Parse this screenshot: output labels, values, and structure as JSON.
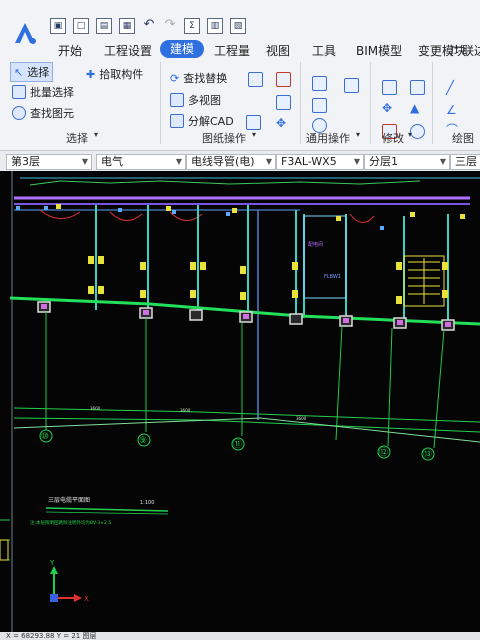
{
  "quick_access": {
    "items": [
      "file-icon",
      "new-icon",
      "open-icon",
      "save-icon",
      "undo-icon",
      "redo-icon",
      "sum-icon",
      "calc-icon",
      "report-icon"
    ]
  },
  "tabs": [
    "开始",
    "工程设置",
    "建模",
    "工程量",
    "视图",
    "工具",
    "BIM模型",
    "变更模块"
  ],
  "brand": "广联达",
  "select_group": {
    "select": "选择",
    "batch_select": "批量选择",
    "find_element": "查找图元",
    "pick_member": "拾取构件",
    "label": "选择"
  },
  "drawing_group": {
    "find_replace": "查找替换",
    "multi_view": "多视图",
    "explode_cad": "分解CAD",
    "label": "图纸操作"
  },
  "common_group": {
    "label": "通用操作"
  },
  "modify_group": {
    "label": "修改"
  },
  "draw_group": {
    "label": "绘图"
  },
  "property_bar": {
    "floor": "第3层",
    "discipline": "电气",
    "category": "电线导管(电)",
    "member": "F3AL-WX5",
    "layer": "分层1",
    "view": "三层"
  },
  "drawing": {
    "axis_labels": [
      "⑩",
      "⑨",
      "⑪",
      "⑫",
      "⑬"
    ],
    "title": "三层电缆平面图",
    "scale": "1:100",
    "note": "注:本层照明回路除注明外均为BV-3×2.5"
  },
  "status_bar": {
    "coords": "X = 68293.88 Y = 21 图层"
  }
}
